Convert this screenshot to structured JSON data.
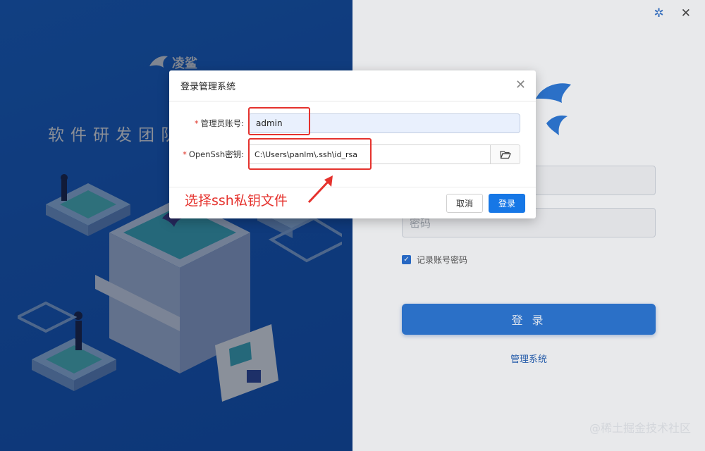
{
  "window": {
    "title_icons": [
      "bug-icon",
      "close-icon"
    ]
  },
  "left": {
    "brand_name": "凌鲨",
    "slogan": "软件研发团队"
  },
  "login_form": {
    "username_placeholder": "",
    "password_placeholder": "密码",
    "remember_label": "记录账号密码",
    "remember_checked": true,
    "login_button": "登 录",
    "manage_link": "管理系统"
  },
  "modal": {
    "title": "登录管理系统",
    "admin_label": "管理员账号:",
    "admin_value": "admin",
    "key_label": "OpenSsh密钥:",
    "key_value": "C:\\Users\\panlm\\.ssh\\id_rsa",
    "cancel": "取消",
    "confirm": "登录"
  },
  "annotation": {
    "text": "选择ssh私钥文件",
    "color": "#e5322d"
  },
  "watermark": "@稀土掘金技术社区",
  "colors": {
    "primary": "#1677e6",
    "left_bg": "#1a5fc9",
    "required": "#e0382c"
  }
}
